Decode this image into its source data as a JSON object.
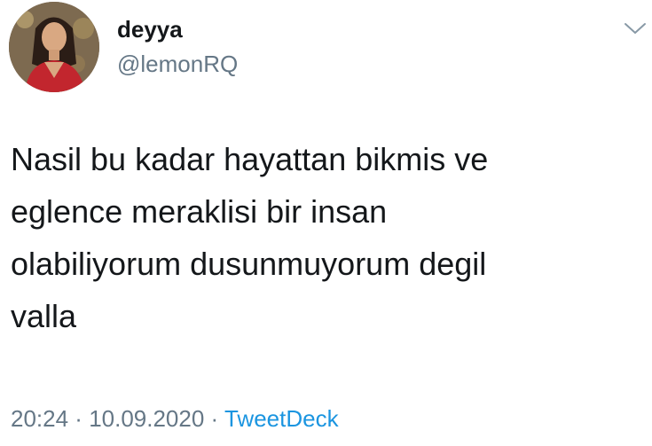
{
  "author": {
    "display_name": "deyya",
    "handle": "@lemonRQ",
    "avatar_icon": "profile-photo"
  },
  "menu": {
    "icon": "chevron-down-icon"
  },
  "tweet": {
    "lines": [
      "Nasil bu kadar hayattan bikmis ve",
      "eglence meraklisi bir insan",
      "olabiliyorum dusunmuyorum degil",
      "valla"
    ]
  },
  "meta": {
    "time": "20:24",
    "separator1": " · ",
    "date": "10.09.2020",
    "separator2": " · ",
    "source": "TweetDeck"
  },
  "colors": {
    "text": "#14171a",
    "secondary": "#657786",
    "link": "#1b95e0"
  }
}
